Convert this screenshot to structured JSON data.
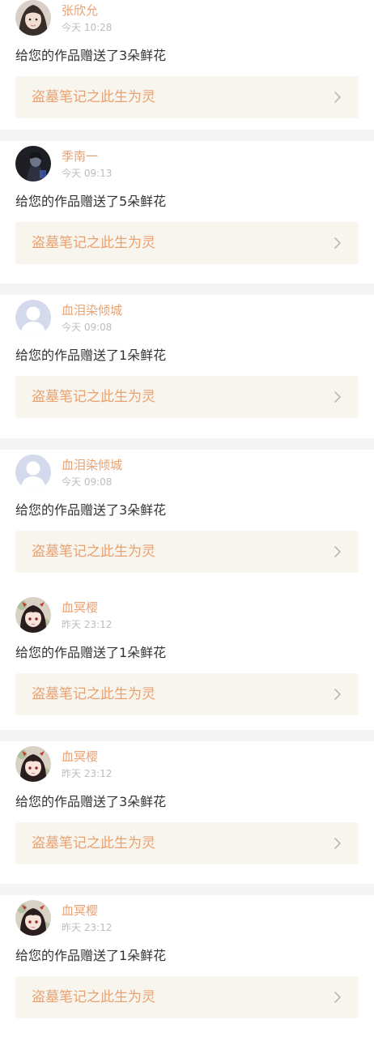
{
  "work_title": "盗墓笔记之此生为灵",
  "colors": {
    "accent": "#e9a170",
    "card_bg": "#f7f5ee",
    "separator": "#f4f4f4",
    "text": "#333333",
    "muted": "#bdbdbd"
  },
  "notifications": [
    {
      "user": "张欣允",
      "time": "今天 10:28",
      "message": "给您的作品赠送了3朵鲜花",
      "work": "盗墓笔记之此生为灵",
      "avatar": "girl-photo"
    },
    {
      "user": "季南一",
      "time": "今天 09:13",
      "message": "给您的作品赠送了5朵鲜花",
      "work": "盗墓笔记之此生为灵",
      "avatar": "dark-photo"
    },
    {
      "user": "血泪染倾城",
      "time": "今天 09:08",
      "message": "给您的作品赠送了1朵鲜花",
      "work": "盗墓笔记之此生为灵",
      "avatar": "default-user"
    },
    {
      "user": "血泪染倾城",
      "time": "今天 09:08",
      "message": "给您的作品赠送了3朵鲜花",
      "work": "盗墓笔记之此生为灵",
      "avatar": "default-user"
    },
    {
      "user": "血冥樱",
      "time": "昨天 23:12",
      "message": "给您的作品赠送了1朵鲜花",
      "work": "盗墓笔记之此生为灵",
      "avatar": "anime-girl"
    },
    {
      "user": "血冥樱",
      "time": "昨天 23:12",
      "message": "给您的作品赠送了3朵鲜花",
      "work": "盗墓笔记之此生为灵",
      "avatar": "anime-girl"
    },
    {
      "user": "血冥樱",
      "time": "昨天 23:12",
      "message": "给您的作品赠送了1朵鲜花",
      "work": "盗墓笔记之此生为灵",
      "avatar": "anime-girl"
    }
  ]
}
